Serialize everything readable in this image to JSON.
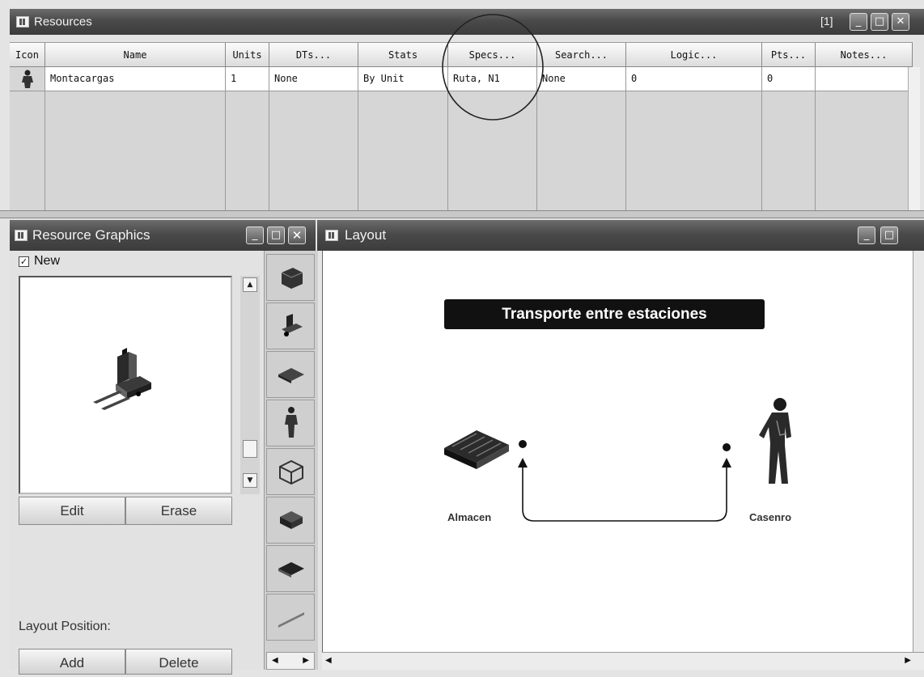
{
  "resources_window": {
    "title": "Resources",
    "controls": {
      "restore": "[1]",
      "minimize": "_",
      "maximize": "□",
      "close": "✕"
    },
    "columns": [
      "Icon",
      "Name",
      "Units",
      "DTs...",
      "Stats",
      "Specs...",
      "Search...",
      "Logic...",
      "Pts...",
      "Notes..."
    ],
    "rows": [
      {
        "icon": "worker-icon",
        "name": "Montacargas",
        "units": "1",
        "dts": "None",
        "stats": "By Unit",
        "specs": "Ruta, N1",
        "search": "None",
        "logic": "0",
        "pts": "0",
        "notes": ""
      }
    ]
  },
  "graphics_window": {
    "title": "Resource Graphics",
    "new_label": "New",
    "new_checked": true,
    "edit_label": "Edit",
    "erase_label": "Erase",
    "layout_position_label": "Layout Position:",
    "add_label": "Add",
    "delete_label": "Delete",
    "library_icons": [
      "printer-icon",
      "forklift-icon",
      "tray-icon",
      "worker-icon",
      "box-icon",
      "crate-icon",
      "pallet-icon",
      "ramp-icon"
    ]
  },
  "layout_window": {
    "title": "Layout",
    "banner": "Transporte entre estaciones",
    "almacen_label": "Almacen",
    "casero_label": "Casenro"
  },
  "colors": {
    "titlebar": "#4a4a4a",
    "banner_bg": "#111111",
    "banner_text": "#ffffff"
  }
}
